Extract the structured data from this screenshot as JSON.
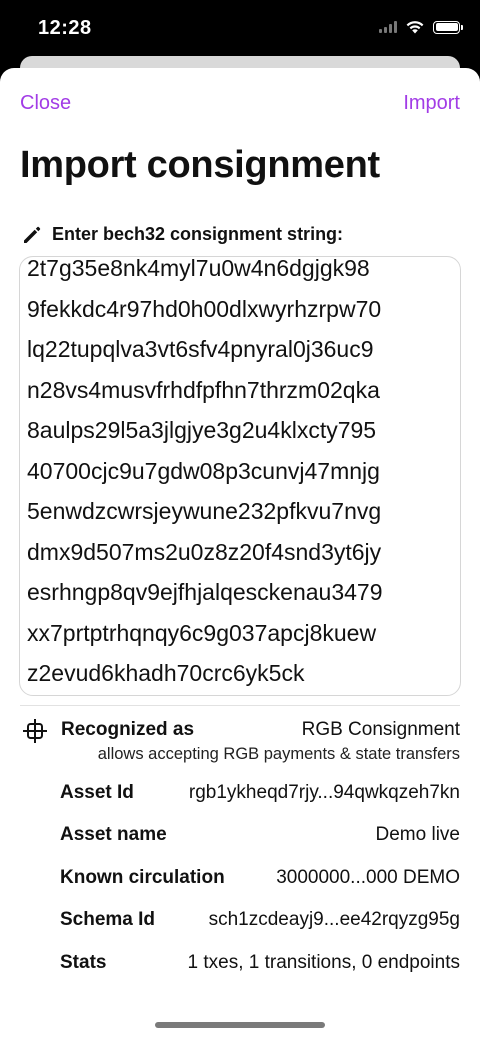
{
  "status_bar": {
    "time": "12:28"
  },
  "nav": {
    "close_label": "Close",
    "import_label": "Import"
  },
  "page_title": "Import consignment",
  "input": {
    "icon": "pencil-icon",
    "label": "Enter bech32 consignment string:",
    "value_lines": [
      "2t7g35e8nk4myl7u0w4n6dgjgk98",
      "9fekkdc4r97hd0h00dlxwyrhzrpw70",
      "lq22tupqlva3vt6sfv4pnyral0j36uc9",
      "n28vs4musvfrhdfpfhn7thrzm02qka",
      "8aulps29l5a3jlgjye3g2u4klxcty795",
      "40700cjc9u7gdw08p3cunvj47mnjg",
      "5enwdzcwrsjeywune232pfkvu7nvg",
      "dmx9d507ms2u0z8z20f4snd3yt6jy",
      "esrhngp8qv9ejfhjalqesckenau3479",
      "xx7prtptrhqnqy6c9g037apcj8kuew",
      "z2evud6khadh70crc6yk5ck"
    ]
  },
  "recognized": {
    "icon": "grid-icon",
    "label": "Recognized as",
    "value": "RGB Consignment",
    "description": "allows accepting RGB payments & state transfers"
  },
  "details": [
    {
      "label": "Asset Id",
      "value": "rgb1ykheqd7rjy...94qwkqzeh7kn"
    },
    {
      "label": "Asset name",
      "value": "Demo live"
    },
    {
      "label": "Known circulation",
      "value": "3000000...000 DEMO"
    },
    {
      "label": "Schema Id",
      "value": "sch1zcdeayj9...ee42rqyzg95g"
    },
    {
      "label": "Stats",
      "value": "1 txes, 1 transitions, 0 endpoints"
    }
  ],
  "colors": {
    "accent": "#a23ce6",
    "text": "#111111",
    "background": "#ffffff",
    "border": "#d6d6d6"
  }
}
